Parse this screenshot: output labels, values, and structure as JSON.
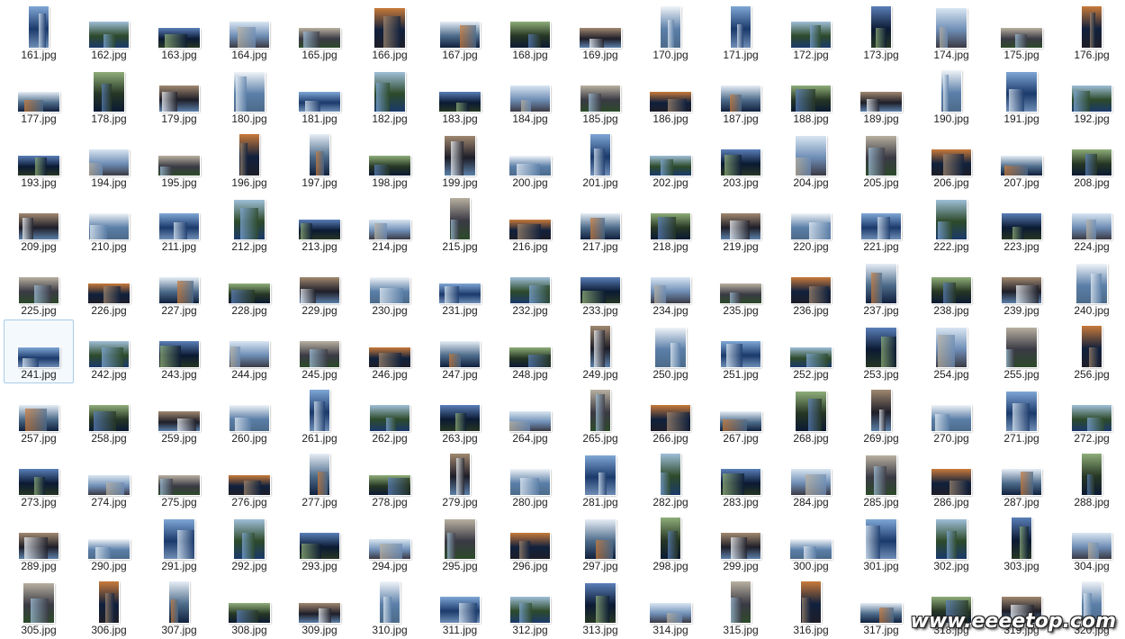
{
  "folder_view": {
    "first_index": 161,
    "last_index": 320,
    "columns": 16,
    "extension": ".jpg",
    "selected_file": "241.jpg",
    "files": [
      "161.jpg",
      "162.jpg",
      "163.jpg",
      "164.jpg",
      "165.jpg",
      "166.jpg",
      "167.jpg",
      "168.jpg",
      "169.jpg",
      "170.jpg",
      "171.jpg",
      "172.jpg",
      "173.jpg",
      "174.jpg",
      "175.jpg",
      "176.jpg",
      "177.jpg",
      "178.jpg",
      "179.jpg",
      "180.jpg",
      "181.jpg",
      "182.jpg",
      "183.jpg",
      "184.jpg",
      "185.jpg",
      "186.jpg",
      "187.jpg",
      "188.jpg",
      "189.jpg",
      "190.jpg",
      "191.jpg",
      "192.jpg",
      "193.jpg",
      "194.jpg",
      "195.jpg",
      "196.jpg",
      "197.jpg",
      "198.jpg",
      "199.jpg",
      "200.jpg",
      "201.jpg",
      "202.jpg",
      "203.jpg",
      "204.jpg",
      "205.jpg",
      "206.jpg",
      "207.jpg",
      "208.jpg",
      "209.jpg",
      "210.jpg",
      "211.jpg",
      "212.jpg",
      "213.jpg",
      "214.jpg",
      "215.jpg",
      "216.jpg",
      "217.jpg",
      "218.jpg",
      "219.jpg",
      "220.jpg",
      "221.jpg",
      "222.jpg",
      "223.jpg",
      "224.jpg",
      "225.jpg",
      "226.jpg",
      "227.jpg",
      "228.jpg",
      "229.jpg",
      "230.jpg",
      "231.jpg",
      "232.jpg",
      "233.jpg",
      "234.jpg",
      "235.jpg",
      "236.jpg",
      "237.jpg",
      "238.jpg",
      "239.jpg",
      "240.jpg",
      "241.jpg",
      "242.jpg",
      "243.jpg",
      "244.jpg",
      "245.jpg",
      "246.jpg",
      "247.jpg",
      "248.jpg",
      "249.jpg",
      "250.jpg",
      "251.jpg",
      "252.jpg",
      "253.jpg",
      "254.jpg",
      "255.jpg",
      "256.jpg",
      "257.jpg",
      "258.jpg",
      "259.jpg",
      "260.jpg",
      "261.jpg",
      "262.jpg",
      "263.jpg",
      "264.jpg",
      "265.jpg",
      "266.jpg",
      "267.jpg",
      "268.jpg",
      "269.jpg",
      "270.jpg",
      "271.jpg",
      "272.jpg",
      "273.jpg",
      "274.jpg",
      "275.jpg",
      "276.jpg",
      "277.jpg",
      "278.jpg",
      "279.jpg",
      "280.jpg",
      "281.jpg",
      "282.jpg",
      "283.jpg",
      "284.jpg",
      "285.jpg",
      "286.jpg",
      "287.jpg",
      "288.jpg",
      "289.jpg",
      "290.jpg",
      "291.jpg",
      "292.jpg",
      "293.jpg",
      "294.jpg",
      "295.jpg",
      "296.jpg",
      "297.jpg",
      "298.jpg",
      "299.jpg",
      "300.jpg",
      "301.jpg",
      "302.jpg",
      "303.jpg",
      "304.jpg",
      "305.jpg",
      "306.jpg",
      "307.jpg",
      "308.jpg",
      "309.jpg",
      "310.jpg",
      "311.jpg",
      "312.jpg",
      "313.jpg",
      "314.jpg",
      "315.jpg",
      "316.jpg",
      "317.jpg",
      "318.jpg",
      "319.jpg",
      "320.jpg"
    ],
    "selection_color": "#a9cce9",
    "thumbnail_palette": [
      [
        "#1b3a6b",
        "#7fa7d6"
      ],
      [
        "#2d4a2a",
        "#9fbfd8"
      ],
      [
        "#0b1a33",
        "#5a7fb8"
      ],
      [
        "#6e8db5",
        "#d9e6f2"
      ],
      [
        "#3a3a44",
        "#b8b0a0"
      ],
      [
        "#10203c",
        "#c87a3a"
      ],
      [
        "#4d6b8a",
        "#e6eef6"
      ],
      [
        "#263624",
        "#8fae7a"
      ],
      [
        "#1e1e28",
        "#a08870"
      ],
      [
        "#5b7fa8",
        "#f0f4f8"
      ]
    ]
  },
  "watermark": {
    "text": "www.eeeetop.com"
  }
}
